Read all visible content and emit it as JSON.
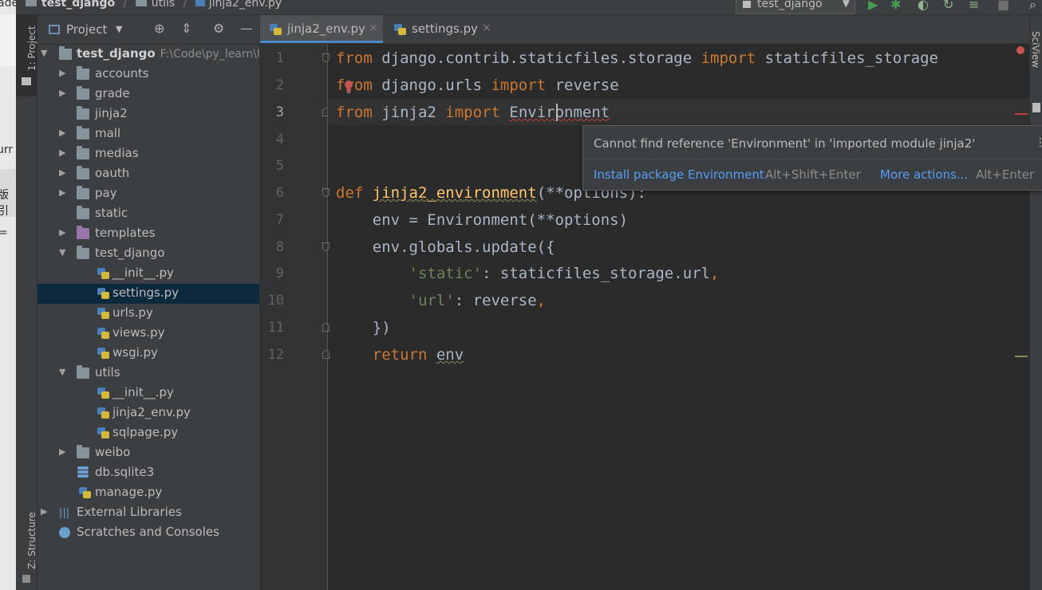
{
  "navbar": {
    "project": "test_django",
    "folder": "utils",
    "file": "jinja2_env.py",
    "run_config": "test_django"
  },
  "tool_stripe": {
    "project_tab": "1: Project",
    "structure_tab": "Z: Structure"
  },
  "right_stripe": {
    "sciview_tab": "SciView"
  },
  "project_panel": {
    "title": "Project",
    "root": {
      "name": "test_django",
      "path": "F:\\Code\\py_learn\\t"
    },
    "items": [
      "accounts",
      "grade",
      "jinja2",
      "mall",
      "medias",
      "oauth",
      "pay",
      "static",
      "templates",
      "test_django",
      "__init__.py",
      "settings.py",
      "urls.py",
      "views.py",
      "wsgi.py",
      "utils",
      "__init__.py",
      "jinja2_env.py",
      "sqlpage.py",
      "weibo",
      "db.sqlite3",
      "manage.py"
    ],
    "external_libraries": "External Libraries",
    "scratches": "Scratches and Consoles"
  },
  "tabs": {
    "active": "jinja2_env.py",
    "second": "settings.py"
  },
  "editor": {
    "line_numbers": [
      "1",
      "2",
      "3",
      "4",
      "5",
      "6",
      "7",
      "8",
      "9",
      "10",
      "11",
      "12"
    ],
    "code": {
      "l1_a": "from",
      "l1_b": " django.contrib.staticfiles.storage ",
      "l1_c": "import",
      "l1_d": " staticfiles_storage",
      "l2_a": "from",
      "l2_b": " django.urls ",
      "l2_c": "import",
      "l2_d": " reverse",
      "l3_a": "from",
      "l3_b": " jinja2 ",
      "l3_c": "import",
      "l3_d": " ",
      "l3_e": "Environment",
      "l6_a": "def",
      "l6_b": " ",
      "l6_c": "jinja2_environment",
      "l6_d": "(**options):",
      "l7": "    env = Environment(**options)",
      "l8": "    env.globals.update({",
      "l9_a": "        ",
      "l9_b": "'static'",
      "l9_c": ": staticfiles_storage.url",
      "l9_d": ",",
      "l10_a": "        ",
      "l10_b": "'url'",
      "l10_c": ": reverse",
      "l10_d": ",",
      "l11": "    })",
      "l12_a": "    ",
      "l12_b": "return",
      "l12_c": " ",
      "l12_d": "env"
    }
  },
  "popup": {
    "message": "Cannot find reference 'Environment' in 'imported module jinja2'",
    "action1": "Install package Environment",
    "shortcut1": "Alt+Shift+Enter",
    "action2": "More actions...",
    "shortcut2": "Alt+Enter"
  },
  "background_window": {
    "glyph1": "ade",
    "glyph2": "urr",
    "glyph3": "版引",
    "glyph4": "="
  },
  "colors": {
    "keyword": "#cc7832",
    "function": "#ffc66d",
    "string": "#6a8759",
    "identifier": "#a9b7c6",
    "link": "#589df6",
    "selection": "#0d293e"
  }
}
